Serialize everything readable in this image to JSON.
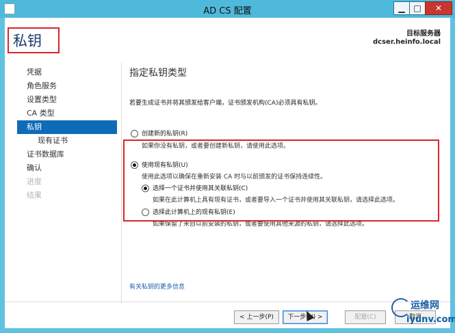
{
  "window": {
    "title": "AD CS 配置",
    "min_glyph": "▁",
    "max_glyph": "□",
    "close_glyph": "✕"
  },
  "header": {
    "page_title": "私钥",
    "target_label": "目标服务器",
    "target_value": "dcser.heinfo.local"
  },
  "sidebar": {
    "items": [
      {
        "label": "凭据",
        "state": "normal",
        "indent": 0
      },
      {
        "label": "角色服务",
        "state": "normal",
        "indent": 0
      },
      {
        "label": "设置类型",
        "state": "normal",
        "indent": 0
      },
      {
        "label": "CA 类型",
        "state": "normal",
        "indent": 0
      },
      {
        "label": "私钥",
        "state": "selected",
        "indent": 0
      },
      {
        "label": "现有证书",
        "state": "normal",
        "indent": 1
      },
      {
        "label": "证书数据库",
        "state": "normal",
        "indent": 0
      },
      {
        "label": "确认",
        "state": "normal",
        "indent": 0
      },
      {
        "label": "进度",
        "state": "disabled",
        "indent": 0
      },
      {
        "label": "结果",
        "state": "disabled",
        "indent": 0
      }
    ]
  },
  "main": {
    "section_title": "指定私钥类型",
    "description": "若要生成证书并将其颁发给客户端，证书颁发机构(CA)必须具有私钥。",
    "option_new": {
      "label": "创建新的私钥(R)",
      "note": "如果你没有私钥，或者要创建新私钥，请使用此选项。",
      "checked": false
    },
    "option_existing": {
      "label": "使用现有私钥(U)",
      "note": "使用此选项以确保在重新安装 CA 时与以前颁发的证书保持连续性。",
      "checked": true
    },
    "sub_option_cert": {
      "label": "选择一个证书并使用其关联私钥(C)",
      "note": "如果在此计算机上具有现有证书，或者要导入一个证书并使用其关联私钥，请选择此选项。",
      "checked": true
    },
    "sub_option_key": {
      "label": "选择此计算机上的现有私钥(E)",
      "note": "如果保留了来自以前安装的私钥，或者要使用其他来源的私钥，请选择此选项。",
      "checked": false
    },
    "more_link": "有关私钥的更多信息"
  },
  "buttons": {
    "back": "< 上一步(P)",
    "next": "下一步(N) >",
    "configure": "配置(C)",
    "cancel": "取消"
  },
  "watermark": {
    "top": "运维网",
    "bottom": "iyunv.com"
  },
  "colors": {
    "accent": "#0f6bb8",
    "highlight_box": "#d9232b",
    "titlebar": "#4fb9dc"
  }
}
